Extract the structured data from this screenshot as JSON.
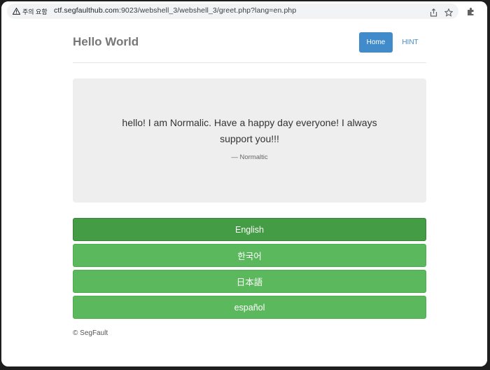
{
  "browser": {
    "security_label": "주의 요함",
    "url_host": "ctf.segfaulthub.com",
    "url_rest": ":9023/webshell_3/webshell_3/greet.php?lang=en.php",
    "icons": [
      "warning-icon",
      "share-icon",
      "bookmark-star-icon",
      "extensions-icon"
    ]
  },
  "header": {
    "brand": "Hello World",
    "nav": {
      "home": "Home",
      "hint": "HINT"
    }
  },
  "greeting": {
    "message": "hello! I am Normalic. Have a happy day everyone! I always support you!!!",
    "attribution": "— Normaltic"
  },
  "languages": [
    {
      "label": "English",
      "active": true
    },
    {
      "label": "한국어",
      "active": false
    },
    {
      "label": "日本語",
      "active": false
    },
    {
      "label": "español",
      "active": false
    }
  ],
  "footer": {
    "text": "© SegFault"
  },
  "colors": {
    "primary": "#428bca",
    "success": "#5cb85c",
    "success_active": "#449d44",
    "jumbotron_bg": "#eeeeee"
  }
}
